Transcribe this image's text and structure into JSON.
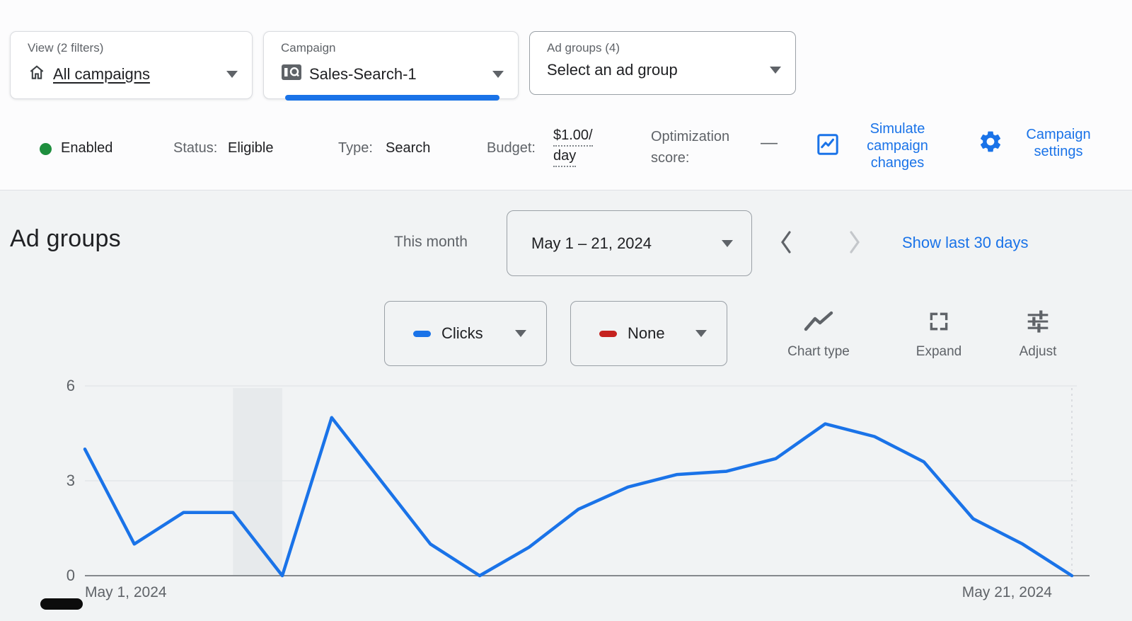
{
  "filters": {
    "view": {
      "label": "View (2 filters)",
      "value": "All campaigns"
    },
    "campaign": {
      "label": "Campaign",
      "value": "Sales-Search-1"
    },
    "ad_groups": {
      "label": "Ad groups (4)",
      "value": "Select an ad group"
    }
  },
  "status": {
    "enabled_label": "Enabled",
    "status_label": "Status:",
    "status_value": "Eligible",
    "type_label": "Type:",
    "type_value": "Search",
    "budget_label": "Budget:",
    "budget_line1": "$1.00/",
    "budget_line2": "day",
    "opt_line1": "Optimization",
    "opt_line2": "score:",
    "opt_value": "—",
    "simulate_label": "Simulate campaign changes",
    "settings_label": "Campaign settings"
  },
  "section": {
    "title": "Ad groups",
    "period_label": "This month",
    "date_range": "May 1 – 21, 2024",
    "show_last_label": "Show last 30 days"
  },
  "controls": {
    "metric1_label": "Clicks",
    "metric2_label": "None",
    "chart_type_label": "Chart type",
    "expand_label": "Expand",
    "adjust_label": "Adjust"
  },
  "colors": {
    "accent_blue": "#1a73e8",
    "enabled_green": "#1e8e3e",
    "metric2_red": "#c5221f",
    "grey_text": "#5f6368"
  },
  "chart_data": {
    "type": "line",
    "title": "Clicks by day",
    "x_unit": "day of May 2024",
    "x": [
      1,
      2,
      3,
      4,
      5,
      6,
      7,
      8,
      9,
      10,
      11,
      12,
      13,
      14,
      15,
      16,
      17,
      18,
      19,
      20,
      21
    ],
    "series": [
      {
        "name": "Clicks",
        "color": "#1a73e8",
        "values": [
          4,
          1,
          2,
          2,
          0,
          5,
          3,
          1,
          0,
          0.9,
          2.1,
          2.8,
          3.2,
          3.3,
          3.7,
          4.8,
          4.4,
          3.6,
          1.8,
          1.0,
          0
        ]
      }
    ],
    "ylim": [
      0,
      6
    ],
    "y_ticks": [
      0,
      3,
      6
    ],
    "grid": true,
    "legend_position": "none",
    "x_axis_labels": [
      "May 1, 2024",
      "May 21, 2024"
    ],
    "highlight_band": {
      "from_day": 4,
      "to_day": 5,
      "color": "#e7eaec"
    },
    "end_of_range_dashed_line_day": 21
  }
}
